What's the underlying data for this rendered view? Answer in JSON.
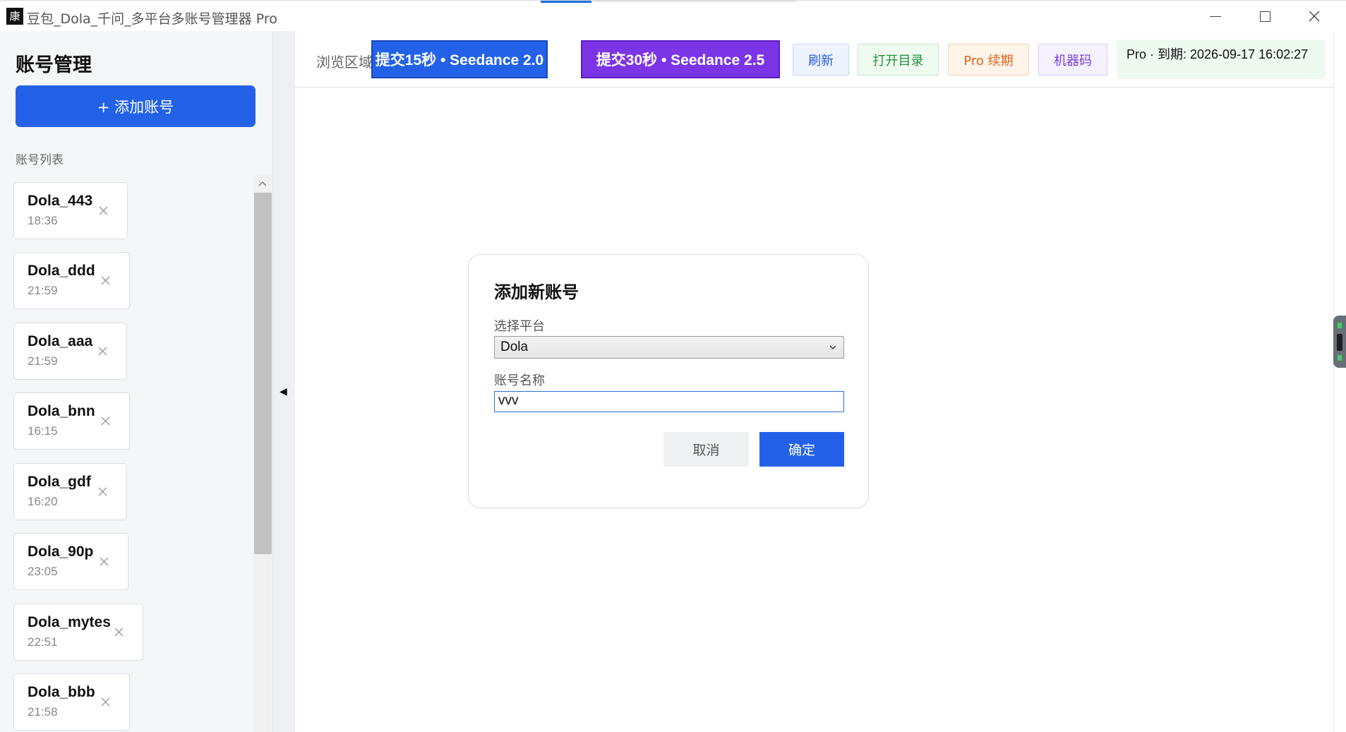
{
  "window": {
    "title": "豆包_Dola_千问_多平台多账号管理器 Pro",
    "icon_glyph": "康"
  },
  "sidebar": {
    "title": "账号管理",
    "add_button_label": "+ 添加账号",
    "list_label": "账号列表",
    "accounts": [
      {
        "name": "Dola_443",
        "time": "18:36"
      },
      {
        "name": "Dola_ddd",
        "time": "21:59"
      },
      {
        "name": "Dola_aaa",
        "time": "21:59"
      },
      {
        "name": "Dola_bnn",
        "time": "16:15"
      },
      {
        "name": "Dola_gdf",
        "time": "16:20"
      },
      {
        "name": "Dola_90p",
        "time": "23:05"
      },
      {
        "name": "Dola_mytes",
        "time": "22:51"
      },
      {
        "name": "Dola_bbb",
        "time": "21:58"
      }
    ]
  },
  "toolbar": {
    "browse_label": "浏览区域",
    "submit_15_label": "提交15秒 • Seedance 2.0",
    "submit_30_label": "提交30秒 • Seedance 2.5",
    "refresh_label": "刷新",
    "open_dir_label": "打开目录",
    "renew_label": "Pro 续期",
    "machine_code_label": "机器码",
    "expiry_text": "Pro · 到期: 2026-09-17 16:02:27"
  },
  "dialog": {
    "title": "添加新账号",
    "platform_label": "选择平台",
    "platform_value": "Dola",
    "name_label": "账号名称",
    "name_value": "vvv",
    "cancel_label": "取消",
    "confirm_label": "确定"
  },
  "colors": {
    "primary_blue": "#2362e8",
    "purple": "#7b35e6",
    "refresh_text": "#2a5ad9",
    "open_dir_text": "#23913b",
    "renew_text": "#e0641a",
    "machine_code_text": "#7b3fd8",
    "expiry_bg": "#eefaf0"
  },
  "icons": {
    "window_controls": [
      "minimize-icon",
      "maximize-icon",
      "close-icon"
    ],
    "account_remove": "close-icon",
    "collapse": "collapse-left-icon",
    "dropdown": "chevron-down-icon",
    "scroll_up": "chevron-up-icon"
  }
}
